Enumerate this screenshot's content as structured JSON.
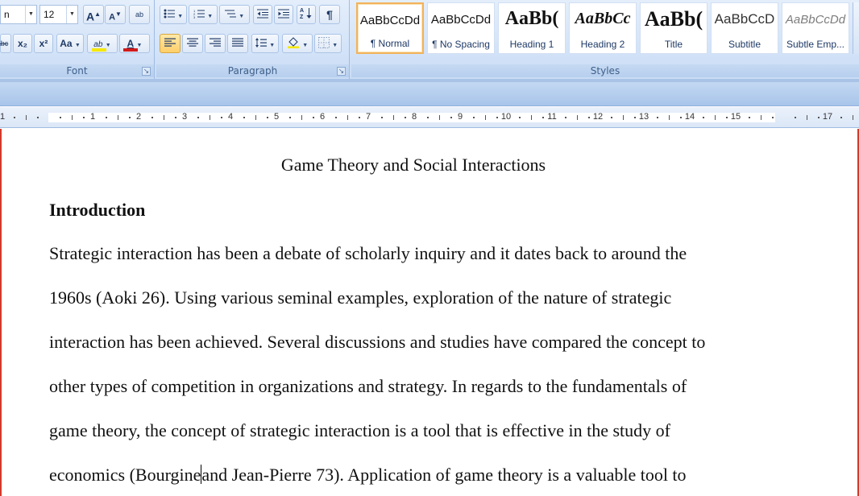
{
  "ribbon": {
    "font_group": {
      "label": "Font",
      "font_name_tail": "n",
      "font_size": "12",
      "grow_font": "A",
      "shrink_font": "A",
      "clear_format": "ab",
      "strikethrough": "abc",
      "subscript": "x₂",
      "superscript": "x²",
      "change_case": "Aa",
      "highlight": "ab",
      "font_color": "A",
      "highlight_color": "#f5e800",
      "font_color_bar": "#d11b1b"
    },
    "paragraph_group": {
      "label": "Paragraph",
      "bullets_icon": "bullets-icon",
      "numbering_icon": "numbering-icon",
      "multilevel_icon": "multilevel-list-icon",
      "decrease_indent_icon": "decrease-indent-icon",
      "increase_indent_icon": "increase-indent-icon",
      "sort_icon": "sort-icon",
      "show_marks": "¶",
      "align_left_icon": "align-left-icon",
      "center_icon": "align-center-icon",
      "align_right_icon": "align-right-icon",
      "justify_icon": "justify-icon",
      "line_spacing_icon": "line-spacing-icon",
      "shading_icon": "shading-icon",
      "borders_icon": "borders-icon"
    },
    "styles_group": {
      "label": "Styles",
      "tiles": [
        {
          "sample": "AaBbCcDd",
          "name": "¶ Normal",
          "selected": true
        },
        {
          "sample": "AaBbCcDd",
          "name": "¶ No Spacing",
          "selected": false
        },
        {
          "sample": "AaBb(",
          "name": "Heading 1",
          "selected": false
        },
        {
          "sample": "AaBbCc",
          "name": "Heading 2",
          "selected": false
        },
        {
          "sample": "AaBb(",
          "name": "Title",
          "selected": false
        },
        {
          "sample": "AaBbCcD",
          "name": "Subtitle",
          "selected": false
        },
        {
          "sample": "AaBbCcDd",
          "name": "Subtle Emp...",
          "selected": false
        }
      ]
    },
    "launcher_glyph": "↘"
  },
  "ruler": {
    "numbers": [
      "1",
      "1",
      "2",
      "3",
      "4",
      "5",
      "6",
      "7",
      "8",
      "9",
      "10",
      "11",
      "12",
      "13",
      "14",
      "15",
      "17"
    ]
  },
  "document": {
    "title": "Game Theory and Social Interactions",
    "heading": "Introduction",
    "lines": [
      "Strategic interaction has been a debate of scholarly inquiry and it dates back to around the",
      "1960s (Aoki 26). Using various seminal examples, exploration of the nature of strategic",
      "interaction has been achieved. Several discussions and studies have compared the concept to",
      "other types of competition in organizations and strategy. In regards to the fundamentals of",
      "game theory, the concept of strategic interaction is a tool that is effective in the study of"
    ],
    "last_line_before_caret": "economics (Bourgine",
    "last_line_after_caret": "and Jean-Pierre 73). Application of game theory is a valuable tool to"
  }
}
